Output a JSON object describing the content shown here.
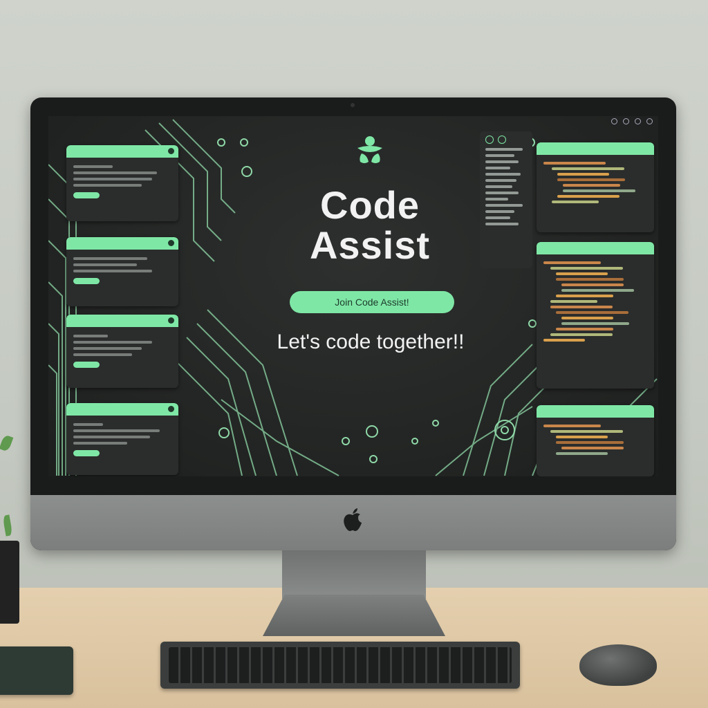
{
  "app": {
    "menu_items": [
      "",
      "",
      "",
      "",
      ""
    ],
    "top_center_label": ""
  },
  "hero": {
    "title_line1": "Code",
    "title_line2": "Assist",
    "join_button_label": "Join Code Assist!",
    "tagline": "Let's code together!!"
  },
  "left_panels": [
    {
      "header": "",
      "button_label": ""
    },
    {
      "header": "",
      "button_label": ""
    },
    {
      "header": "",
      "button_label": ""
    },
    {
      "header": "",
      "button_label": ""
    }
  ],
  "right_panels": [
    {
      "header": ""
    },
    {
      "header": ""
    },
    {
      "header": ""
    }
  ],
  "colors": {
    "accent": "#7fe7a6",
    "screen_bg": "#232524",
    "panel_bg": "#2b2d2c",
    "text": "#f2f2f2"
  },
  "icons": [
    "brand-logo-icon",
    "apple-logo-icon",
    "status-icon"
  ]
}
